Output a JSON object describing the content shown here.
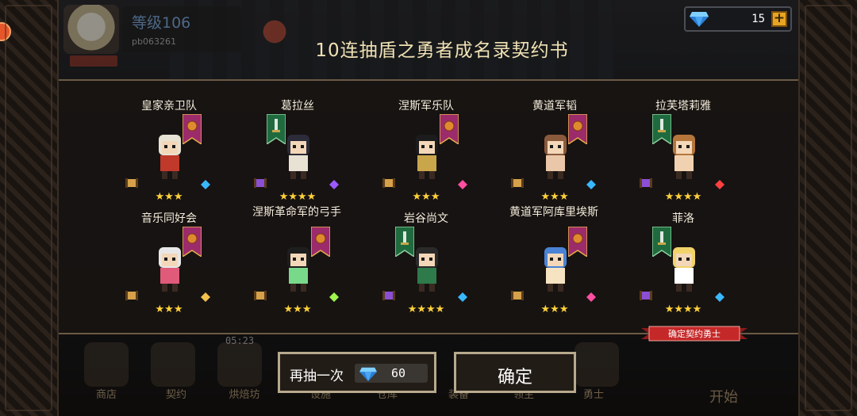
{
  "profile": {
    "level": "等级106",
    "user_id": "pb063261"
  },
  "currency": {
    "icon": "diamond-icon",
    "amount": "15",
    "plus": "+"
  },
  "title": "10连抽盾之勇者成名录契约书",
  "heroes": [
    {
      "name": "皇家亲卫队",
      "stars": "★★★",
      "rarity": 3,
      "banner": "gold-shield-banner"
    },
    {
      "name": "葛拉丝",
      "stars": "★★★★",
      "rarity": 4,
      "banner": "green-sword-banner"
    },
    {
      "name": "涅斯军乐队",
      "stars": "★★★",
      "rarity": 3,
      "banner": "gold-shield-banner"
    },
    {
      "name": "黄道军韬",
      "stars": "★★★",
      "rarity": 3,
      "banner": "gold-shield-banner"
    },
    {
      "name": "拉芙塔莉雅",
      "stars": "★★★★",
      "rarity": 4,
      "banner": "green-sword-banner"
    },
    {
      "name": "音乐同好会",
      "stars": "★★★",
      "rarity": 3,
      "banner": "gold-shield-banner"
    },
    {
      "name": "涅斯革命军的弓手",
      "stars": "★★★",
      "rarity": 3,
      "banner": "gold-shield-banner"
    },
    {
      "name": "岩谷尚文",
      "stars": "★★★★",
      "rarity": 4,
      "banner": "green-sword-banner"
    },
    {
      "name": "黄道军阿库里埃斯",
      "stars": "★★★",
      "rarity": 3,
      "banner": "gold-shield-banner"
    },
    {
      "name": "菲洛",
      "stars": "★★★★",
      "rarity": 4,
      "banner": "green-sword-banner"
    }
  ],
  "confirm_ribbon": "确定契约勇士",
  "buttons": {
    "redraw": "再抽一次",
    "redraw_cost": "60",
    "confirm": "确定"
  },
  "bottom_nav": {
    "items": [
      "商店",
      "契约",
      "烘焙坊",
      "设施",
      "仓库",
      "装备",
      "领主",
      "勇士"
    ],
    "start": "开始",
    "timer": "05:23"
  },
  "colors": {
    "star": "#ffd23a",
    "banner_gold": "#9c2b6b",
    "banner_green": "#1f6b3f",
    "gem": "#3ab8ff"
  }
}
